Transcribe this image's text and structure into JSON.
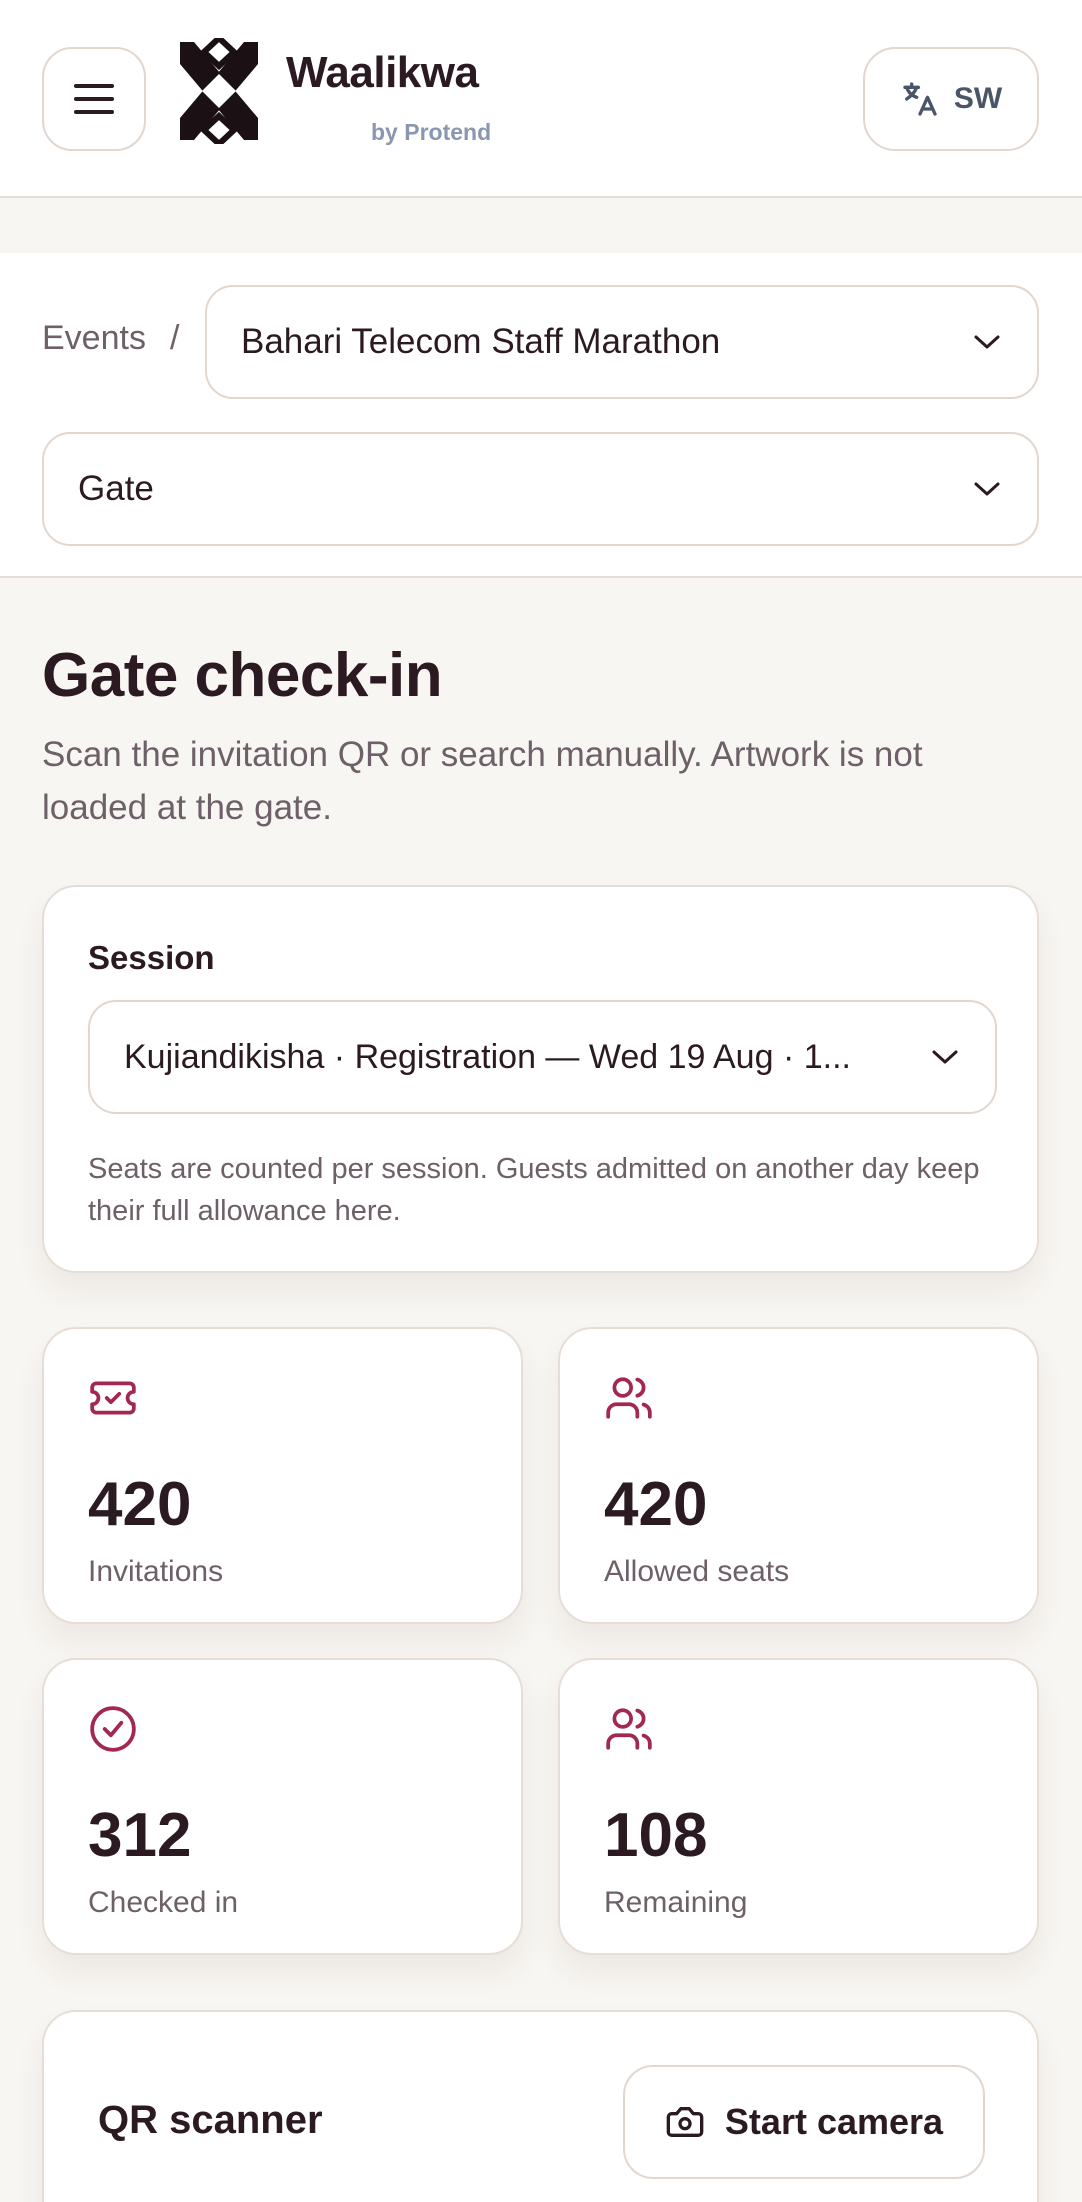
{
  "header": {
    "brand_name": "Waalikwa",
    "brand_sub": "by Protend",
    "menu_icon": "menu-icon",
    "logo_icon": "waalikwa-logo",
    "language": {
      "label": "SW",
      "icon": "translate-icon"
    }
  },
  "nav": {
    "breadcrumb_root": "Events",
    "breadcrumb_separator": "/",
    "event_select_value": "Bahari Telecom Staff Marathon",
    "gate_select_value": "Gate"
  },
  "page": {
    "title": "Gate check-in",
    "description": "Scan the invitation QR or search manually. Artwork is not loaded at the gate."
  },
  "session": {
    "label": "Session",
    "selected": "Kujiandikisha · Registration — Wed 19 Aug · 1...",
    "help": "Seats are counted per session. Guests admitted on another day keep their full allowance here."
  },
  "stats": [
    {
      "value": "420",
      "label": "Invitations",
      "icon": "ticket-check-icon"
    },
    {
      "value": "420",
      "label": "Allowed seats",
      "icon": "users-icon"
    },
    {
      "value": "312",
      "label": "Checked in",
      "icon": "check-circle-icon"
    },
    {
      "value": "108",
      "label": "Remaining",
      "icon": "users-icon"
    }
  ],
  "scanner": {
    "title": "QR scanner",
    "start_button": "Start camera",
    "camera_icon": "camera-icon"
  },
  "colors": {
    "accent": "#a3284f",
    "text": "#2b1a22",
    "muted": "#6e6068",
    "border": "#e6ddd6",
    "background": "#f8f6f2"
  }
}
